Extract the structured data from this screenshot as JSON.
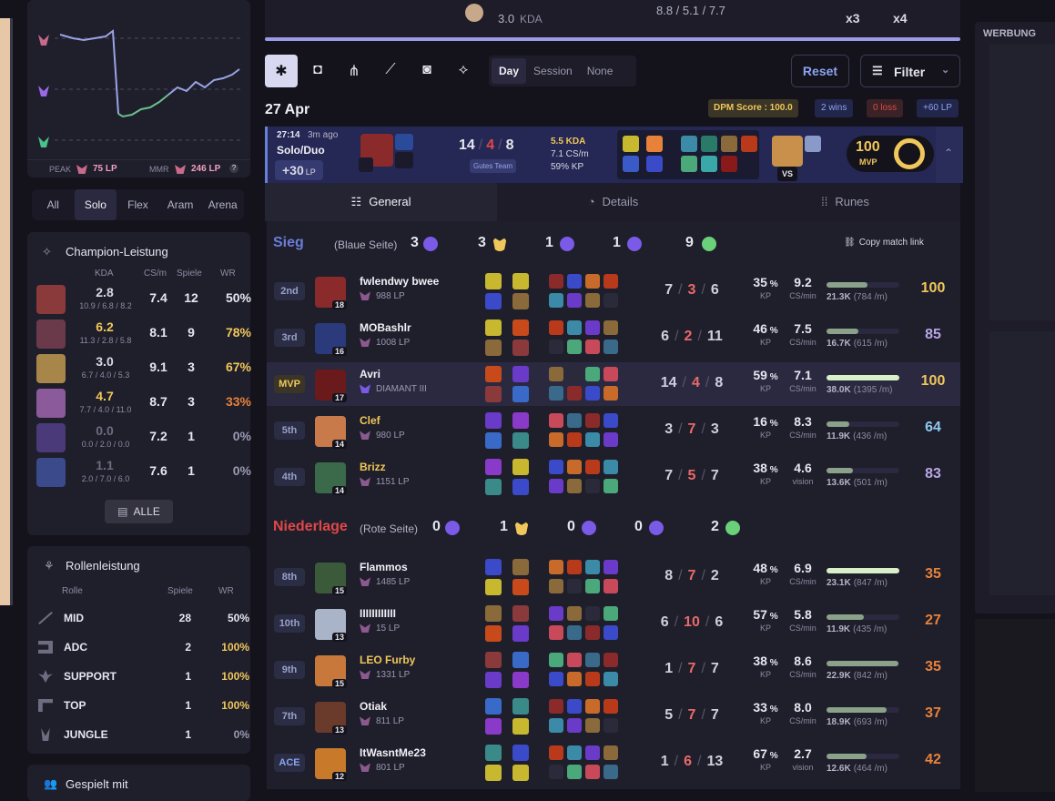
{
  "colors": {
    "accent": "#5b59b0",
    "win": "#6a7ed8",
    "loss": "#e04848",
    "gold": "#f0c75a",
    "orange": "#e8823a",
    "bg": "#14131c",
    "panel": "#1f1e2b"
  },
  "top_partial": {
    "kda_text": "3.0",
    "kda_label": "KDA",
    "kda_scores": "8.8 / 5.1 / 7.7",
    "x3": "x3",
    "x4": "x4"
  },
  "lp_graph": {
    "peak_label": "PEAK",
    "peak_value": "75 LP",
    "mmr_label": "MMR",
    "mmr_value": "246 LP",
    "help": "?"
  },
  "queue_tabs": [
    {
      "label": "All"
    },
    {
      "label": "Solo",
      "selected": true
    },
    {
      "label": "Flex"
    },
    {
      "label": "Aram"
    },
    {
      "label": "Arena"
    }
  ],
  "champion_perf": {
    "title": "Champion-Leistung",
    "headers": {
      "kda": "KDA",
      "cs": "CS/m",
      "games": "Spiele",
      "wr": "WR"
    },
    "rows": [
      {
        "kda": "2.8",
        "kd": "10.9 / 6.8 / 8.2",
        "cs": "7.4",
        "games": "12",
        "wr": "50%",
        "kda_color": "#d8d8e6",
        "wr_color": "#e6e6f0",
        "img": "#8a3a3a"
      },
      {
        "kda": "6.2",
        "kd": "11.3 / 2.8 / 5.8",
        "cs": "8.1",
        "games": "9",
        "wr": "78%",
        "kda_color": "#f0c75a",
        "wr_color": "#f0c75a",
        "img": "#6a3a4a"
      },
      {
        "kda": "3.0",
        "kd": "6.7 / 4.0 / 5.3",
        "cs": "9.1",
        "games": "3",
        "wr": "67%",
        "kda_color": "#d8d8e6",
        "wr_color": "#f0c75a",
        "img": "#a8864a"
      },
      {
        "kda": "4.7",
        "kd": "7.7 / 4.0 / 11.0",
        "cs": "8.7",
        "games": "3",
        "wr": "33%",
        "kda_color": "#f0c75a",
        "wr_color": "#e8823a",
        "img": "#8a5a9a"
      },
      {
        "kda": "0.0",
        "kd": "0.0 / 2.0 / 0.0",
        "cs": "7.2",
        "games": "1",
        "wr": "0%",
        "kda_color": "#6d6c80",
        "wr_color": "#9a99b0",
        "img": "#4a3a7a"
      },
      {
        "kda": "1.1",
        "kd": "2.0 / 7.0 / 6.0",
        "cs": "7.6",
        "games": "1",
        "wr": "0%",
        "kda_color": "#6d6c80",
        "wr_color": "#9a99b0",
        "img": "#3a4a8a"
      }
    ],
    "all_button": "ALLE"
  },
  "role_perf": {
    "title": "Rollenleistung",
    "headers": {
      "role": "Rolle",
      "games": "Spiele",
      "wr": "WR"
    },
    "rows": [
      {
        "role": "MID",
        "games": "28",
        "wr": "50%",
        "wr_color": "#e6e6f0"
      },
      {
        "role": "ADC",
        "games": "2",
        "wr": "100%",
        "wr_color": "#f0c75a"
      },
      {
        "role": "SUPPORT",
        "games": "1",
        "wr": "100%",
        "wr_color": "#f0c75a"
      },
      {
        "role": "TOP",
        "games": "1",
        "wr": "100%",
        "wr_color": "#f0c75a"
      },
      {
        "role": "JUNGLE",
        "games": "1",
        "wr": "0%",
        "wr_color": "#9a99b0"
      }
    ]
  },
  "played_with": {
    "title": "Gespielt mit"
  },
  "filter_bar": {
    "periods": [
      "Day",
      "Session",
      "None"
    ],
    "selected_period": "Day",
    "reset": "Reset",
    "filter": "Filter"
  },
  "date_row": {
    "date": "27 Apr",
    "dpm_score": "DPM Score : 100.0",
    "wins": "2 wins",
    "loss": "0 loss",
    "lp": "+60 LP"
  },
  "match": {
    "duration": "27:14",
    "ago": "3m ago",
    "queue": "Solo/Duo",
    "lp_gain": "+30",
    "lp_unit": "LP",
    "k": "14",
    "d": "4",
    "a": "8",
    "badge": "Gutes Team",
    "kda": "5.5 KDA",
    "cspm": "7.1 CS/m",
    "kp": "59% KP",
    "vs": "VS",
    "score": "100",
    "mvp": "MVP"
  },
  "detail_tabs": [
    {
      "label": "General",
      "selected": true
    },
    {
      "label": "Details"
    },
    {
      "label": "Runes"
    }
  ],
  "ad_label": "WERBUNG",
  "teams": [
    {
      "result": "Sieg",
      "side": "(Blaue Seite)",
      "result_color": "#6a7ed8",
      "objectives": [
        "3",
        "3",
        "1",
        "1",
        "9"
      ],
      "copy_link": "Copy match link",
      "players": [
        {
          "rank": "2nd",
          "name": "fwlendwy bwee",
          "lp": "988 LP",
          "level": "18",
          "k": "7",
          "d": "3",
          "a": "6",
          "kp": "35",
          "cs": "9.2",
          "cs_label": "CS/min",
          "dmg": "21.3K",
          "dmg_pm": "(784 /m)",
          "dmg_frac": 0.56,
          "score": "100",
          "score_color": "#f0c75a",
          "name_color": "#f0f0f6",
          "img": "#8a2a2a"
        },
        {
          "rank": "3rd",
          "name": "MOBashlr",
          "lp": "1008 LP",
          "level": "16",
          "k": "6",
          "d": "2",
          "a": "11",
          "kp": "46",
          "cs": "7.5",
          "cs_label": "CS/min",
          "dmg": "16.7K",
          "dmg_pm": "(615 /m)",
          "dmg_frac": 0.44,
          "score": "85",
          "score_color": "#b9a6e6",
          "name_color": "#f0f0f6",
          "img": "#2a3a7a"
        },
        {
          "rank": "MVP",
          "name": "Avri",
          "lp": "DIAMANT III",
          "level": "17",
          "k": "14",
          "d": "4",
          "a": "8",
          "kp": "59",
          "cs": "7.1",
          "cs_label": "CS/min",
          "dmg": "38.0K",
          "dmg_pm": "(1395 /m)",
          "dmg_frac": 1.0,
          "score": "100",
          "score_color": "#f0c75a",
          "name_color": "#f0f0f6",
          "img": "#6a1a1a",
          "mvp": true
        },
        {
          "rank": "5th",
          "name": "Clef",
          "lp": "980 LP",
          "level": "14",
          "k": "3",
          "d": "7",
          "a": "3",
          "kp": "16",
          "cs": "8.3",
          "cs_label": "CS/min",
          "dmg": "11.9K",
          "dmg_pm": "(436 /m)",
          "dmg_frac": 0.31,
          "score": "64",
          "score_color": "#8ec9f0",
          "name_color": "#f0c75a",
          "img": "#c87a4a"
        },
        {
          "rank": "4th",
          "name": "Brizz",
          "lp": "1151 LP",
          "level": "14",
          "k": "7",
          "d": "5",
          "a": "7",
          "kp": "38",
          "cs": "4.6",
          "cs_label": "vision",
          "dmg": "13.6K",
          "dmg_pm": "(501 /m)",
          "dmg_frac": 0.36,
          "score": "83",
          "score_color": "#b9a6e6",
          "name_color": "#f0c75a",
          "img": "#3a6a4a"
        }
      ]
    },
    {
      "result": "Niederlage",
      "side": "(Rote Seite)",
      "result_color": "#e04848",
      "objectives": [
        "0",
        "1",
        "0",
        "0",
        "2"
      ],
      "players": [
        {
          "rank": "8th",
          "name": "Flammos",
          "lp": "1485 LP",
          "level": "15",
          "k": "8",
          "d": "7",
          "a": "2",
          "kp": "48",
          "cs": "6.9",
          "cs_label": "CS/min",
          "dmg": "23.1K",
          "dmg_pm": "(847 /m)",
          "dmg_frac": 1.0,
          "score": "35",
          "score_color": "#e8823a",
          "name_color": "#f0f0f6",
          "img": "#3a5a3a"
        },
        {
          "rank": "10th",
          "name": "IIIIIIIIIIII",
          "lp": "15 LP",
          "level": "13",
          "k": "6",
          "d": "10",
          "a": "6",
          "kp": "57",
          "cs": "5.8",
          "cs_label": "CS/min",
          "dmg": "11.9K",
          "dmg_pm": "(435 /m)",
          "dmg_frac": 0.51,
          "score": "27",
          "score_color": "#e8823a",
          "name_color": "#f0f0f6",
          "img": "#aab4c8"
        },
        {
          "rank": "9th",
          "name": "LEO Furby",
          "lp": "1331 LP",
          "level": "15",
          "k": "1",
          "d": "7",
          "a": "7",
          "kp": "38",
          "cs": "8.6",
          "cs_label": "CS/min",
          "dmg": "22.9K",
          "dmg_pm": "(842 /m)",
          "dmg_frac": 0.99,
          "score": "35",
          "score_color": "#e8823a",
          "name_color": "#f0c75a",
          "img": "#c8783a"
        },
        {
          "rank": "7th",
          "name": "Otiak",
          "lp": "811 LP",
          "level": "13",
          "k": "5",
          "d": "7",
          "a": "7",
          "kp": "33",
          "cs": "8.0",
          "cs_label": "CS/min",
          "dmg": "18.9K",
          "dmg_pm": "(693 /m)",
          "dmg_frac": 0.82,
          "score": "37",
          "score_color": "#e8823a",
          "name_color": "#f0f0f6",
          "img": "#6a3a2a"
        },
        {
          "rank": "ACE",
          "name": "ItWasntMe23",
          "lp": "801 LP",
          "level": "12",
          "k": "1",
          "d": "6",
          "a": "13",
          "kp": "67",
          "cs": "2.7",
          "cs_label": "vision",
          "dmg": "12.6K",
          "dmg_pm": "(464 /m)",
          "dmg_frac": 0.55,
          "score": "42",
          "score_color": "#e8823a",
          "name_color": "#f0f0f6",
          "img": "#c87a2a",
          "ace": true
        }
      ]
    }
  ]
}
